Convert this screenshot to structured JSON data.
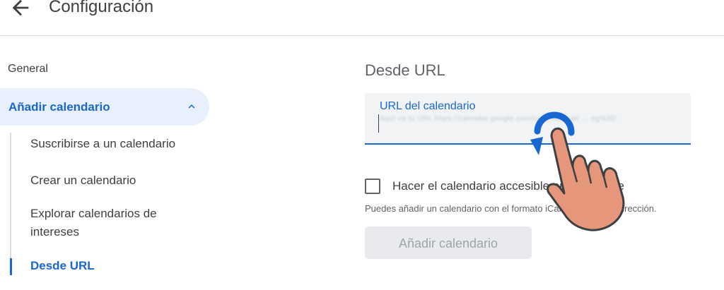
{
  "header": {
    "title": "Configuración",
    "back_icon": "arrow-back-icon"
  },
  "sidebar": {
    "general": "General",
    "add_calendar": "Añadir calendario",
    "subitems": [
      {
        "label": "Suscribirse a un calendario"
      },
      {
        "label": "Crear un calendario"
      },
      {
        "label": "Explorar calendarios de intereses"
      },
      {
        "label": "Desde URL",
        "active": true
      }
    ]
  },
  "main": {
    "section_title": "Desde URL",
    "url_field": {
      "label": "URL del calendario",
      "value": "Aquí va tu URL https://calendar.google.com/calendar/ical/ ... eg%3D"
    },
    "checkbox_label": "Hacer el calendario accesible públicamente",
    "hint": "Puedes añadir un calendario con el formato iCal utilizando su dirección.",
    "add_button": "Añadir calendario"
  },
  "colors": {
    "accent": "#1967d2",
    "active_bg": "#e8f0fe",
    "hand": "#e5967b"
  }
}
